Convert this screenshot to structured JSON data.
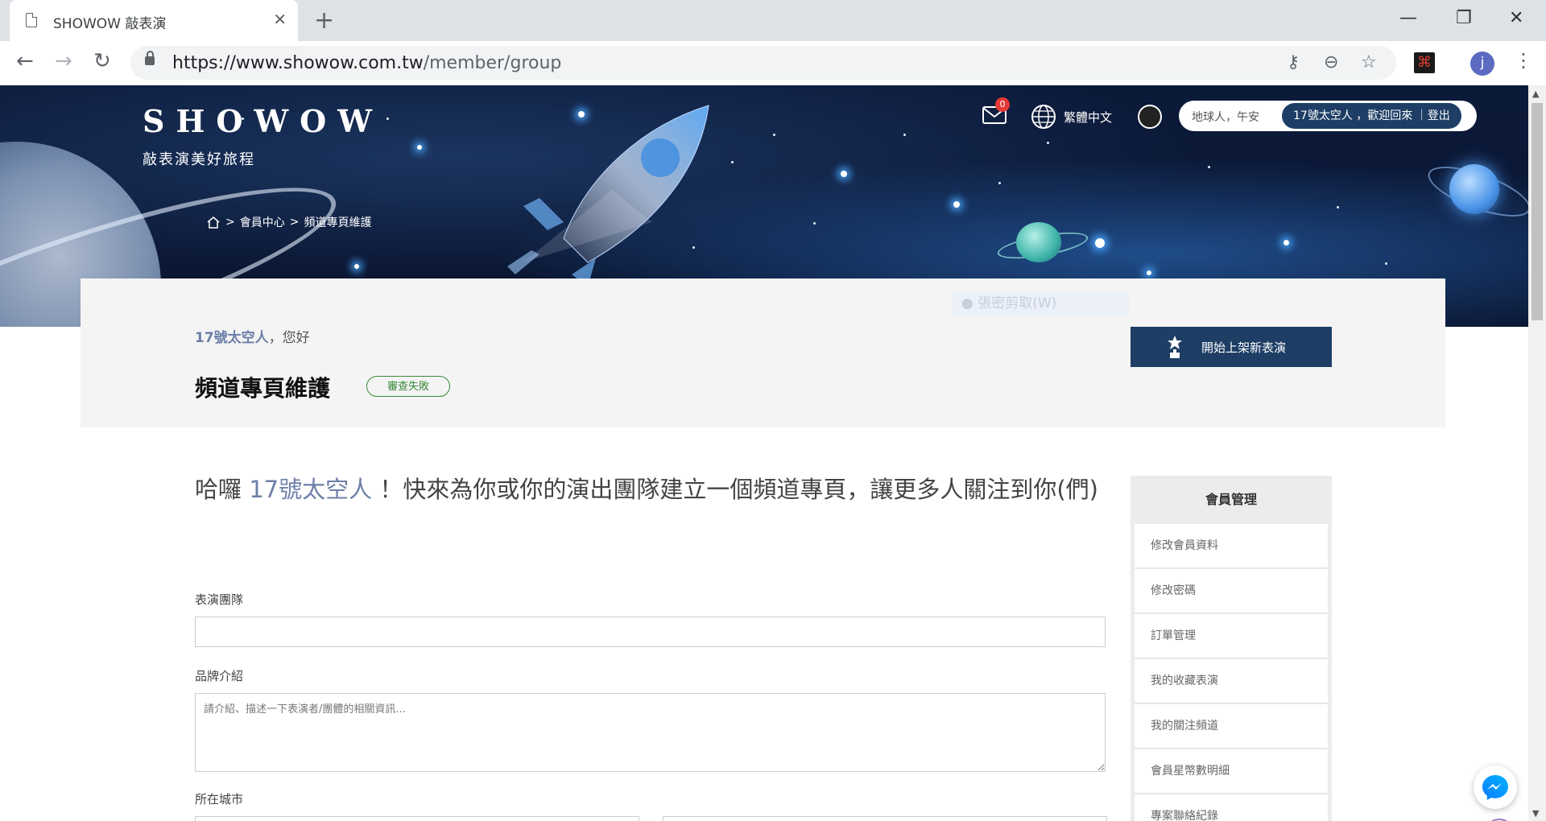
{
  "browser": {
    "tab_title": "SHOWOW 敲表演",
    "tab_close": "✕",
    "new_tab": "+",
    "url_host": "https://www.showow.com.tw",
    "url_path": "/member/group",
    "profile_initial": "j",
    "window_controls": [
      "minimize",
      "restore",
      "close"
    ]
  },
  "header": {
    "brand_name": "SHOWOW",
    "tagline": "敲表演美好旅程",
    "mail_count": "0",
    "language": "繁體中文",
    "greeting": "地球人，午安",
    "welcome": "17號太空人 ，歡迎回來 ｜登出",
    "breadcrumb": [
      ">",
      "會員中心",
      ">",
      "頻道專頁維護"
    ]
  },
  "panel": {
    "hello_user": "17號太空人",
    "hello_suffix": "，您好",
    "title": "頻道專頁維護",
    "status": "審查失敗",
    "publish_button": "開始上架新表演",
    "ghost_tooltip": "● 張密剪取(W)"
  },
  "form": {
    "headline_prefix": "哈囉 ",
    "headline_user": "17號太空人",
    "headline_suffix": " ！快來為你或你的演出團隊建立一個頻道專頁，讓更多人關注到你(們)",
    "team_label": "表演團隊",
    "team_value": "",
    "brand_label": "品牌介紹",
    "brand_placeholder": "請介紹、描述一下表演者/團體的相關資訊...",
    "city_label": "所在城市"
  },
  "sidebar": {
    "title": "會員管理",
    "items": [
      {
        "label": "修改會員資料"
      },
      {
        "label": "修改密碼"
      },
      {
        "label": "訂單管理"
      },
      {
        "label": "我的收藏表演"
      },
      {
        "label": "我的關注頻道"
      },
      {
        "label": "會員星幣數明細"
      },
      {
        "label": "專案聯絡紀錄"
      }
    ]
  },
  "colors": {
    "navy": "#1e3e66",
    "user_highlight": "#6d7fa8",
    "status_green": "#3a8a3a",
    "badge_red": "#e53935"
  }
}
